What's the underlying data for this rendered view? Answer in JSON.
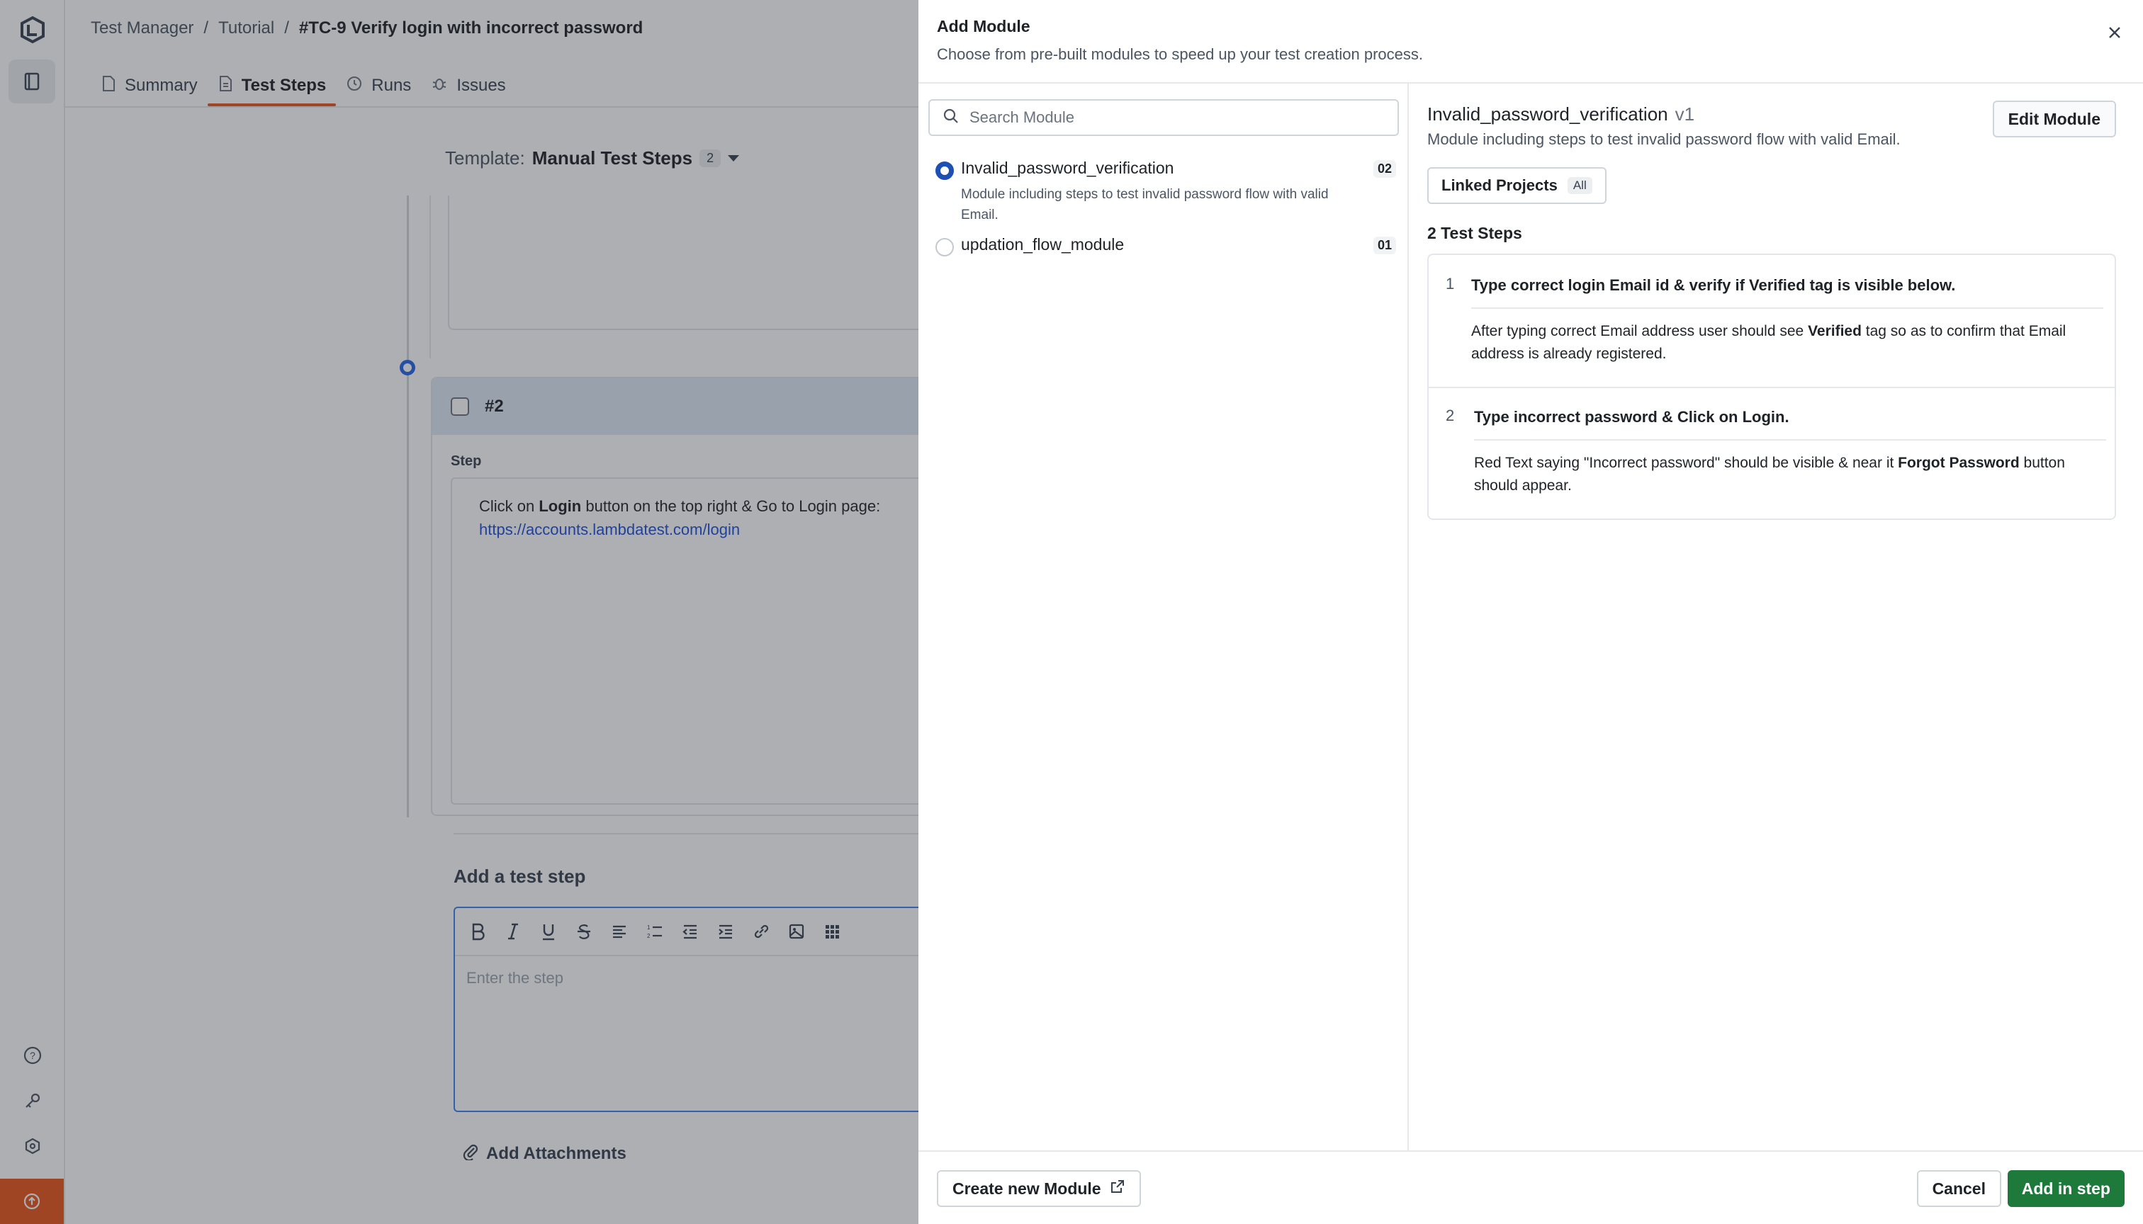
{
  "app": {
    "rail_icons": [
      "lambdatest-logo-icon",
      "test-manager-icon",
      "help-icon",
      "key-icon",
      "integrations-icon",
      "upgrade-icon"
    ]
  },
  "breadcrumb": {
    "root": "Test Manager",
    "sep1": "/",
    "project": "Tutorial",
    "sep2": "/",
    "current": "#TC-9 Verify login with incorrect password"
  },
  "tabs": [
    {
      "label": "Summary",
      "icon": "document-icon"
    },
    {
      "label": "Test Steps",
      "icon": "steps-icon",
      "active": true
    },
    {
      "label": "Runs",
      "icon": "history-icon"
    },
    {
      "label": "Issues",
      "icon": "bug-icon"
    }
  ],
  "template": {
    "label": "Template:",
    "name": "Manual Test Steps",
    "count": "2"
  },
  "step2": {
    "number": "#2",
    "step_label": "Step",
    "text_before": "Click on ",
    "text_bold": "Login",
    "text_after": " button on the top right & Go to Login page: ",
    "link": "https://accounts.lambdatest.com/login"
  },
  "add_step": {
    "title": "Add a test step",
    "placeholder": "Enter the step",
    "attachments": "Add Attachments"
  },
  "drawer": {
    "title": "Add Module",
    "subtitle": "Choose from pre-built modules to speed up your test creation process.",
    "search_placeholder": "Search Module",
    "modules": [
      {
        "name": "Invalid_password_verification",
        "description": "Module including steps to test invalid password flow with valid Email.",
        "count": "02",
        "selected": true
      },
      {
        "name": "updation_flow_module",
        "description": "",
        "count": "01",
        "selected": false
      }
    ],
    "detail": {
      "title": "Invalid_password_verification",
      "version": "v1",
      "description": "Module including steps to test invalid password flow with valid Email.",
      "edit_label": "Edit Module",
      "linked_label": "Linked Projects",
      "linked_value": "All",
      "steps_count": "2 Test Steps",
      "steps": [
        {
          "num": "1",
          "step": "Type correct login Email id & verify if Verified tag is visible below.",
          "result_a": "After typing correct Email address user should see ",
          "result_bold": "Verified",
          "result_b": " tag so as to confirm that Email address is already registered."
        },
        {
          "num": "2",
          "step": "Type incorrect password & Click on Login.",
          "result_a": "Red Text saying \"Incorrect password\" should be visible & near it ",
          "result_bold": "Forgot Password",
          "result_b": " button should appear."
        }
      ]
    },
    "footer": {
      "create_label": "Create new Module",
      "cancel_label": "Cancel",
      "add_label": "Add in step"
    }
  },
  "colors": {
    "accent": "#e8541a",
    "primary_blue": "#1e4fb3",
    "success": "#1e7a3a",
    "link": "#1d4ed8"
  }
}
